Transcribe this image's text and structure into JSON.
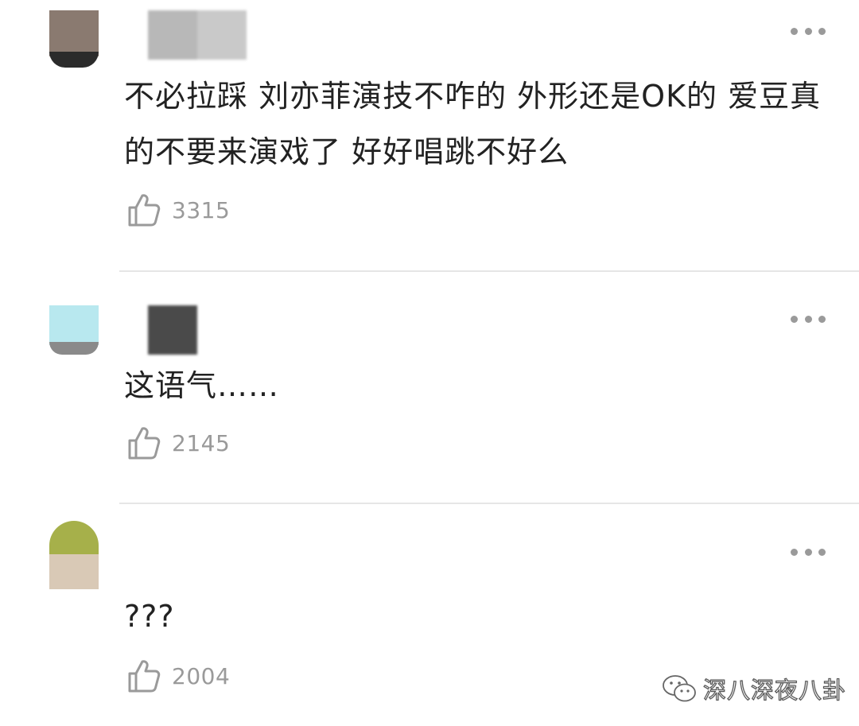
{
  "comments": [
    {
      "text": "不必拉踩 刘亦菲演技不咋的 外形还是OK的 爱豆真的不要来演戏了 好好唱跳不好么",
      "likes": "3315",
      "avatar_colors": [
        "#8a7a70",
        "#2b2b2b"
      ]
    },
    {
      "text": "这语气……",
      "likes": "2145",
      "avatar_colors": [
        "#b8e8ef",
        "#8a8a8a"
      ]
    },
    {
      "text": "???",
      "likes": "2004",
      "avatar_colors": [
        "#a6b04a",
        "#d9c9b6"
      ]
    }
  ],
  "icons": {
    "like": "thumbs-up-icon",
    "more": "more-dots-icon",
    "watermark": "wechat-icon"
  },
  "watermark": {
    "text": "深八深夜八卦"
  },
  "colors": {
    "text": "#222222",
    "meta": "#9a9a9a",
    "divider": "#e6e6e6",
    "background": "#ffffff"
  }
}
